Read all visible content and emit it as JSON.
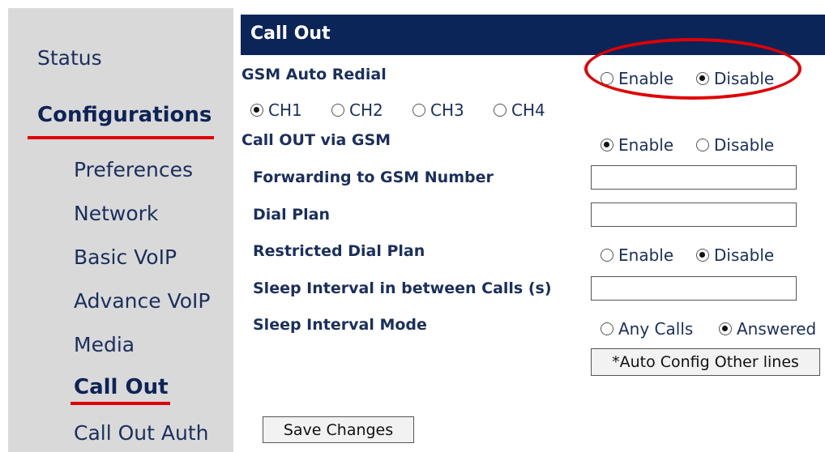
{
  "sidebar": {
    "status": "Status",
    "configurations": "Configurations",
    "items": [
      "Preferences",
      "Network",
      "Basic VoIP",
      "Advance VoIP",
      "Media",
      "Call Out",
      "Call Out Auth"
    ]
  },
  "header": {
    "title": "Call Out"
  },
  "form": {
    "gsm_auto_redial": {
      "label": "GSM Auto Redial",
      "enable": "Enable",
      "disable": "Disable",
      "selected": "Disable"
    },
    "channels": {
      "options": [
        "CH1",
        "CH2",
        "CH3",
        "CH4"
      ],
      "selected": "CH1"
    },
    "call_out_via_gsm": {
      "label": "Call OUT via GSM",
      "enable": "Enable",
      "disable": "Disable",
      "selected": "Enable"
    },
    "forwarding_to_gsm_number": {
      "label": "Forwarding to GSM Number",
      "value": ""
    },
    "dial_plan": {
      "label": "Dial Plan",
      "value": ""
    },
    "restricted_dial_plan": {
      "label": "Restricted Dial Plan",
      "enable": "Enable",
      "disable": "Disable",
      "selected": "Disable"
    },
    "sleep_interval": {
      "label": "Sleep Interval in between Calls (s)",
      "value": ""
    },
    "sleep_interval_mode": {
      "label": "Sleep Interval Mode",
      "any": "Any Calls",
      "answered": "Answered",
      "selected": "Answered"
    },
    "auto_config_button": "*Auto Config Other lines",
    "save_button": "Save Changes"
  },
  "colors": {
    "header_bg": "#0b2559",
    "sidebar_bg": "#d9d9d9",
    "highlight": "#e00000",
    "text": "#1b2f5c"
  }
}
